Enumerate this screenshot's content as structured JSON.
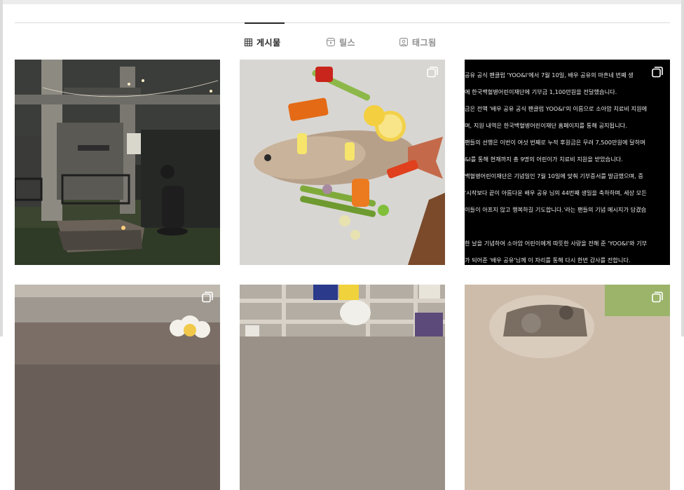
{
  "tabs": [
    {
      "label": "게시물",
      "icon": "grid-icon",
      "active": true
    },
    {
      "label": "릴스",
      "icon": "reels-icon",
      "active": false
    },
    {
      "label": "태그됨",
      "icon": "tagged-icon",
      "active": false
    }
  ],
  "posts": [
    {
      "subject": "night-house-photo",
      "multi": false
    },
    {
      "subject": "fish-dish-photo",
      "multi": true
    },
    {
      "subject": "notice-text-post",
      "multi": true,
      "lines": [
        "공유 공식 팬클럽 'YOO&I'에서 7월 10일, 배우 공유의 마흔네 번째 생",
        "에 한국백혈병어린이재단에 기부금 1,100만원을 전달했습니다.",
        "",
        "금은 전액 '배우 공유 공식 팬클럽 YOO&I'의 이름으로 소아암 치료비 지원에",
        "며, 지원 내역은 한국백혈병어린이재단 홈페이지를 통해 공지됩니다.",
        "",
        "팬들의 선행은 이번이 여섯 번째로 누적 후원금은 무려 7,500만원에 달하며",
        "&I를 통해 현재까지 총 9명의 어린이가 치료비 지원을 받았습니다.",
        "",
        "백혈병어린이재단은 기념일인 7월 10일에 맞춰 기부증서를 발급했으며, 증",
        "'시작보다 끝이 아름다운 배우 공유 님의 44번째 생일을 축하하며, 세상 모든",
        "이들이 아프지 않고 행복하길 기도합니다.'라는 팬들의 기념 메시지가 담겼습",
        "",
        "",
        "한 날을 기념하여 소아암 어린이에게 따뜻한 사랑을 전해 준 'YOO&I'와 기부",
        "가 되어준 '배우 공유'님께 이 자리를 통해 다시 한번 감사를 전합니다."
      ]
    },
    {
      "subject": "interior-flower-photo",
      "multi": true
    },
    {
      "subject": "shelf-cap-photo",
      "multi": false
    },
    {
      "subject": "small-animal-photo",
      "multi": true
    }
  ]
}
